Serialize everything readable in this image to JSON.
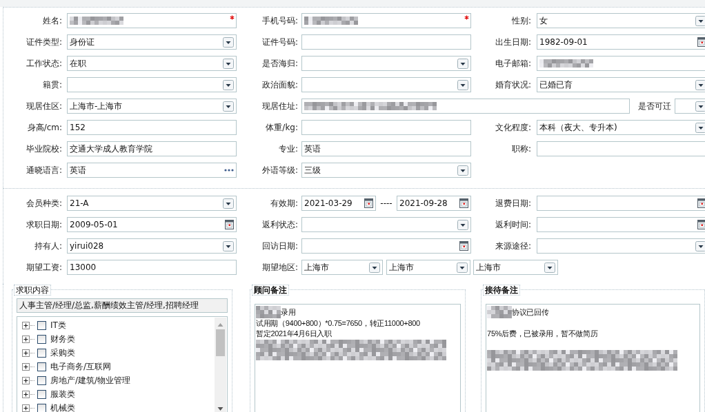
{
  "personal": {
    "rows": [
      [
        {
          "label": "姓名:",
          "kind": "text",
          "value_blurred": true,
          "required": true
        },
        {
          "label": "手机号码:",
          "kind": "text",
          "value_blurred": true,
          "required": true
        },
        {
          "label": "性别:",
          "kind": "select",
          "value": "女"
        }
      ],
      [
        {
          "label": "证件类型:",
          "kind": "select",
          "value": "身份证"
        },
        {
          "label": "证件号码:",
          "kind": "text"
        },
        {
          "label": "出生日期:",
          "kind": "date",
          "value": "1982-09-01"
        }
      ],
      [
        {
          "label": "工作状态:",
          "kind": "select",
          "value": "在职"
        },
        {
          "label": "是否海归:",
          "kind": "select"
        },
        {
          "label": "电子邮箱:",
          "kind": "text",
          "value_blurred": true
        }
      ],
      [
        {
          "label": "籍贯:",
          "kind": "select"
        },
        {
          "label": "政治面貌:",
          "kind": "select"
        },
        {
          "label": "婚育状况:",
          "kind": "select",
          "value": "已婚已育"
        }
      ],
      [
        {
          "label": "现居住区:",
          "kind": "select",
          "value": "上海市-上海市"
        },
        {
          "label": "现居住址:",
          "kind": "wide",
          "value_blurred": true
        },
        {
          "label": "是否可迁",
          "kind": "select"
        }
      ],
      [
        {
          "label": "身高/cm:",
          "kind": "text",
          "value": "152"
        },
        {
          "label": "体重/kg:",
          "kind": "text"
        },
        {
          "label": "文化程度:",
          "kind": "select",
          "value": "本科（夜大、专升本)"
        }
      ],
      [
        {
          "label": "毕业院校:",
          "kind": "text",
          "value": "交通大学成人教育学院"
        },
        {
          "label": "专业:",
          "kind": "text",
          "value": "英语"
        },
        {
          "label": "职称:",
          "kind": "text"
        }
      ],
      [
        {
          "label": "通晓语言:",
          "kind": "lookup",
          "value": "英语"
        },
        {
          "label": "外语等级:",
          "kind": "select",
          "value": "三级"
        }
      ]
    ]
  },
  "membership": {
    "rows": [
      [
        {
          "label": "会员种类:",
          "kind": "select",
          "value": "21-A"
        },
        {
          "label": "有效期:",
          "kind": "date_range",
          "value": "2021-03-29",
          "separator": "----",
          "value_to": "2021-09-28"
        },
        {
          "label": "退费日期:",
          "kind": "date"
        }
      ],
      [
        {
          "label": "求职日期:",
          "kind": "date",
          "value": "2009-05-01"
        },
        {
          "label": "返利状态:",
          "kind": "select"
        },
        {
          "label": "返利时间:",
          "kind": "date"
        }
      ],
      [
        {
          "label": "持有人:",
          "kind": "select",
          "value": "yirui028"
        },
        {
          "label": "回访日期:",
          "kind": "date"
        },
        {
          "label": "来源途径:",
          "kind": "select"
        }
      ],
      [
        {
          "label": "期望工资:",
          "kind": "text",
          "value": "13000"
        },
        {
          "label": "期望地区:",
          "kind": "multi_select",
          "values": [
            "上海市",
            "上海市",
            "上海市"
          ]
        }
      ]
    ]
  },
  "job_intent": {
    "title": "求职内容",
    "summary": "人事主管/经理/总监,薪酬绩效主管/经理,招聘经理",
    "tree": [
      {
        "label": "IT类",
        "checked": false,
        "expanded": false
      },
      {
        "label": "财务类",
        "checked": false,
        "expanded": false
      },
      {
        "label": "采购类",
        "checked": false,
        "expanded": false
      },
      {
        "label": "电子商务/互联网",
        "checked": false,
        "expanded": false
      },
      {
        "label": "房地产/建筑/物业管理",
        "checked": false,
        "expanded": false
      },
      {
        "label": "服装类",
        "checked": false,
        "expanded": false
      },
      {
        "label": "机械类",
        "checked": false,
        "expanded": false
      }
    ]
  },
  "consultant_notes": {
    "title": "顾问备注",
    "lines": [
      {
        "kind": "blur_text",
        "text": "录用"
      },
      {
        "kind": "text",
        "text": "试用期（9400+800）*0.75=7650，转正11000+800"
      },
      {
        "kind": "text",
        "text": "暂定2021年4月6日入职"
      },
      {
        "kind": "blur"
      }
    ]
  },
  "reception_notes": {
    "title": "接待备注",
    "lines": [
      {
        "kind": "blur_text",
        "text": "协议已回传"
      },
      {
        "kind": "blank"
      },
      {
        "kind": "text",
        "text": "75%后费，已被录用，暂不做简历"
      },
      {
        "kind": "blank"
      },
      {
        "kind": "blur"
      }
    ]
  }
}
